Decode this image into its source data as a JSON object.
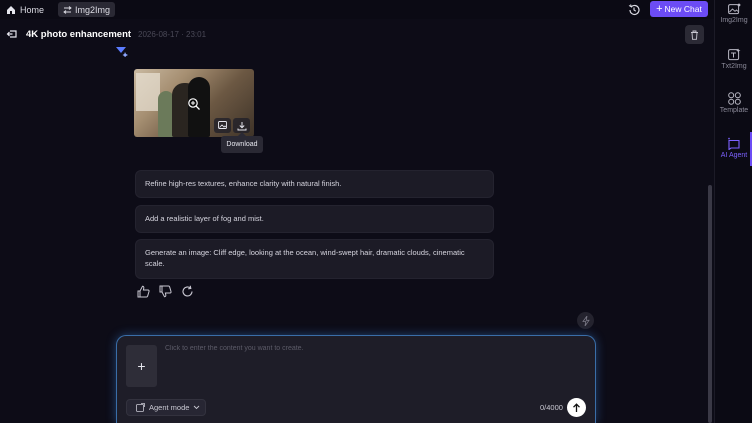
{
  "topbar": {
    "home_label": "Home",
    "tab_label": "Img2Img",
    "new_chat_label": "New Chat"
  },
  "header": {
    "title": "4K photo enhancement",
    "timestamp": "2026-08-17 · 23:01"
  },
  "result": {
    "tooltip": "Download"
  },
  "suggestions": [
    "Refine high-res textures, enhance clarity with natural finish.",
    "Add a realistic layer of fog and mist.",
    "Generate an image: Cliff edge, looking at the ocean, wind-swept hair, dramatic clouds, cinematic scale."
  ],
  "composer": {
    "placeholder": "Click to enter the content you want to create.",
    "mode_label": "Agent mode",
    "char_count": "0/4000"
  },
  "sidebar": {
    "items": [
      {
        "label": "Img2Img",
        "icon": "image-edit-icon"
      },
      {
        "label": "Txt2Img",
        "icon": "text-image-icon"
      },
      {
        "label": "Template",
        "icon": "template-grid-icon"
      },
      {
        "label": "AI Agent",
        "icon": "ai-agent-icon",
        "active": true
      }
    ]
  },
  "colors": {
    "accent": "#6c4cf5",
    "background": "#0d0c17",
    "input_glow": "#3a6ea8"
  }
}
